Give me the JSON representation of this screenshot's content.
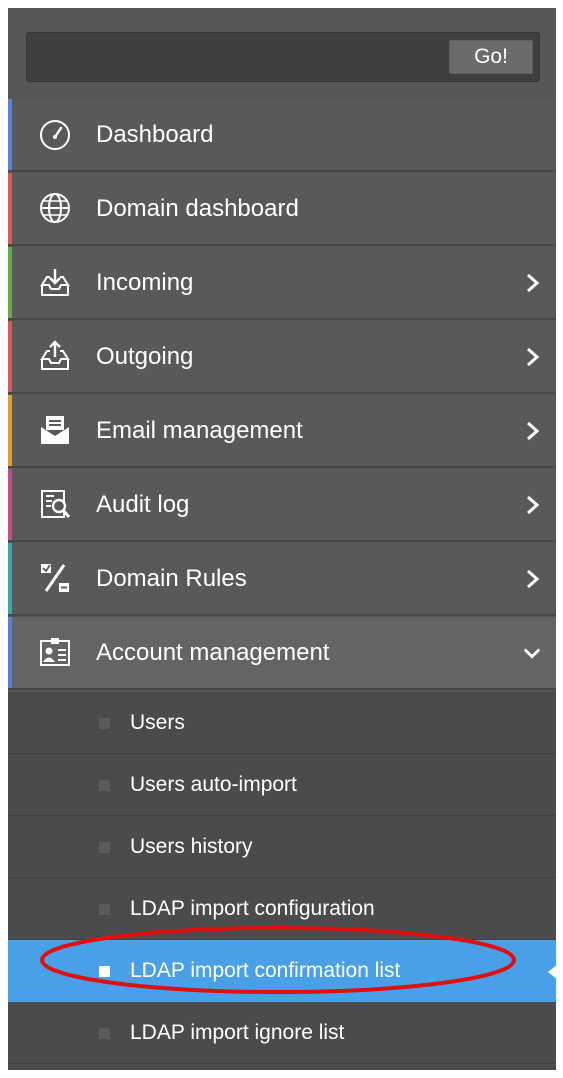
{
  "search": {
    "placeholder": "",
    "go_label": "Go!"
  },
  "menu": [
    {
      "label": "Dashboard",
      "icon": "dashboard-gauge-icon",
      "accent": "#5b7fd6",
      "has_chevron": false
    },
    {
      "label": "Domain dashboard",
      "icon": "globe-icon",
      "accent": "#d35a5a",
      "has_chevron": false
    },
    {
      "label": "Incoming",
      "icon": "incoming-tray-icon",
      "accent": "#6aa84f",
      "has_chevron": true
    },
    {
      "label": "Outgoing",
      "icon": "outgoing-tray-icon",
      "accent": "#d35a5a",
      "has_chevron": true
    },
    {
      "label": "Email management",
      "icon": "email-envelope-icon",
      "accent": "#e0a030",
      "has_chevron": true
    },
    {
      "label": "Audit log",
      "icon": "audit-log-search-icon",
      "accent": "#c0508a",
      "has_chevron": true
    },
    {
      "label": "Domain Rules",
      "icon": "percent-rules-icon",
      "accent": "#3fa6a0",
      "has_chevron": true
    },
    {
      "label": "Account management",
      "icon": "account-card-icon",
      "accent": "#5b7fd6",
      "has_chevron": true,
      "expanded": true
    }
  ],
  "submenu": [
    {
      "label": "Users",
      "active": false
    },
    {
      "label": "Users auto-import",
      "active": false
    },
    {
      "label": "Users history",
      "active": false
    },
    {
      "label": "LDAP import configuration",
      "active": false
    },
    {
      "label": "LDAP import confirmation list",
      "active": true
    },
    {
      "label": "LDAP import ignore list",
      "active": false
    }
  ],
  "colors": {
    "sidebar_bg": "#545557",
    "active_bg": "#4aa0e6",
    "annotation_ring": "#e01010"
  }
}
